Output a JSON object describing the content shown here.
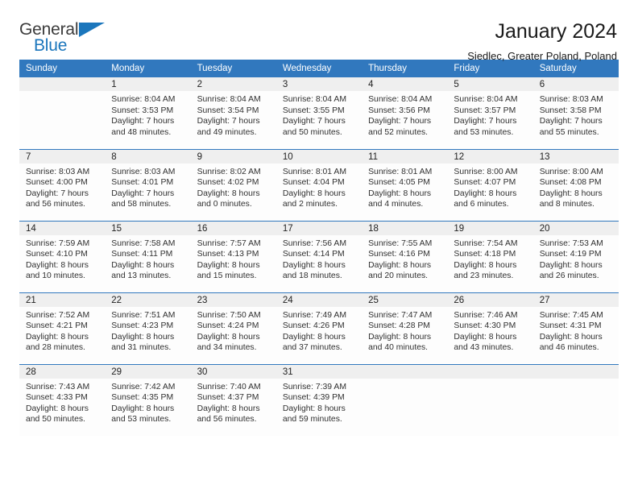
{
  "brand": {
    "word_one": "General",
    "word_two": "Blue",
    "accent_color": "#1b76bc",
    "triangle_icon": "triangle-icon"
  },
  "header": {
    "title": "January 2024",
    "subtitle": "Siedlec, Greater Poland, Poland"
  },
  "calendar": {
    "header_bg": "#3178be",
    "daynum_bg": "#efefef",
    "weekday_headers": [
      "Sunday",
      "Monday",
      "Tuesday",
      "Wednesday",
      "Thursday",
      "Friday",
      "Saturday"
    ],
    "weeks": [
      [
        {
          "day": "",
          "sunrise": "",
          "sunset": "",
          "daylight_line1": "",
          "daylight_line2": "",
          "empty": true
        },
        {
          "day": "1",
          "sunrise": "Sunrise: 8:04 AM",
          "sunset": "Sunset: 3:53 PM",
          "daylight_line1": "Daylight: 7 hours",
          "daylight_line2": "and 48 minutes."
        },
        {
          "day": "2",
          "sunrise": "Sunrise: 8:04 AM",
          "sunset": "Sunset: 3:54 PM",
          "daylight_line1": "Daylight: 7 hours",
          "daylight_line2": "and 49 minutes."
        },
        {
          "day": "3",
          "sunrise": "Sunrise: 8:04 AM",
          "sunset": "Sunset: 3:55 PM",
          "daylight_line1": "Daylight: 7 hours",
          "daylight_line2": "and 50 minutes."
        },
        {
          "day": "4",
          "sunrise": "Sunrise: 8:04 AM",
          "sunset": "Sunset: 3:56 PM",
          "daylight_line1": "Daylight: 7 hours",
          "daylight_line2": "and 52 minutes."
        },
        {
          "day": "5",
          "sunrise": "Sunrise: 8:04 AM",
          "sunset": "Sunset: 3:57 PM",
          "daylight_line1": "Daylight: 7 hours",
          "daylight_line2": "and 53 minutes."
        },
        {
          "day": "6",
          "sunrise": "Sunrise: 8:03 AM",
          "sunset": "Sunset: 3:58 PM",
          "daylight_line1": "Daylight: 7 hours",
          "daylight_line2": "and 55 minutes."
        }
      ],
      [
        {
          "day": "7",
          "sunrise": "Sunrise: 8:03 AM",
          "sunset": "Sunset: 4:00 PM",
          "daylight_line1": "Daylight: 7 hours",
          "daylight_line2": "and 56 minutes."
        },
        {
          "day": "8",
          "sunrise": "Sunrise: 8:03 AM",
          "sunset": "Sunset: 4:01 PM",
          "daylight_line1": "Daylight: 7 hours",
          "daylight_line2": "and 58 minutes."
        },
        {
          "day": "9",
          "sunrise": "Sunrise: 8:02 AM",
          "sunset": "Sunset: 4:02 PM",
          "daylight_line1": "Daylight: 8 hours",
          "daylight_line2": "and 0 minutes."
        },
        {
          "day": "10",
          "sunrise": "Sunrise: 8:01 AM",
          "sunset": "Sunset: 4:04 PM",
          "daylight_line1": "Daylight: 8 hours",
          "daylight_line2": "and 2 minutes."
        },
        {
          "day": "11",
          "sunrise": "Sunrise: 8:01 AM",
          "sunset": "Sunset: 4:05 PM",
          "daylight_line1": "Daylight: 8 hours",
          "daylight_line2": "and 4 minutes."
        },
        {
          "day": "12",
          "sunrise": "Sunrise: 8:00 AM",
          "sunset": "Sunset: 4:07 PM",
          "daylight_line1": "Daylight: 8 hours",
          "daylight_line2": "and 6 minutes."
        },
        {
          "day": "13",
          "sunrise": "Sunrise: 8:00 AM",
          "sunset": "Sunset: 4:08 PM",
          "daylight_line1": "Daylight: 8 hours",
          "daylight_line2": "and 8 minutes."
        }
      ],
      [
        {
          "day": "14",
          "sunrise": "Sunrise: 7:59 AM",
          "sunset": "Sunset: 4:10 PM",
          "daylight_line1": "Daylight: 8 hours",
          "daylight_line2": "and 10 minutes."
        },
        {
          "day": "15",
          "sunrise": "Sunrise: 7:58 AM",
          "sunset": "Sunset: 4:11 PM",
          "daylight_line1": "Daylight: 8 hours",
          "daylight_line2": "and 13 minutes."
        },
        {
          "day": "16",
          "sunrise": "Sunrise: 7:57 AM",
          "sunset": "Sunset: 4:13 PM",
          "daylight_line1": "Daylight: 8 hours",
          "daylight_line2": "and 15 minutes."
        },
        {
          "day": "17",
          "sunrise": "Sunrise: 7:56 AM",
          "sunset": "Sunset: 4:14 PM",
          "daylight_line1": "Daylight: 8 hours",
          "daylight_line2": "and 18 minutes."
        },
        {
          "day": "18",
          "sunrise": "Sunrise: 7:55 AM",
          "sunset": "Sunset: 4:16 PM",
          "daylight_line1": "Daylight: 8 hours",
          "daylight_line2": "and 20 minutes."
        },
        {
          "day": "19",
          "sunrise": "Sunrise: 7:54 AM",
          "sunset": "Sunset: 4:18 PM",
          "daylight_line1": "Daylight: 8 hours",
          "daylight_line2": "and 23 minutes."
        },
        {
          "day": "20",
          "sunrise": "Sunrise: 7:53 AM",
          "sunset": "Sunset: 4:19 PM",
          "daylight_line1": "Daylight: 8 hours",
          "daylight_line2": "and 26 minutes."
        }
      ],
      [
        {
          "day": "21",
          "sunrise": "Sunrise: 7:52 AM",
          "sunset": "Sunset: 4:21 PM",
          "daylight_line1": "Daylight: 8 hours",
          "daylight_line2": "and 28 minutes."
        },
        {
          "day": "22",
          "sunrise": "Sunrise: 7:51 AM",
          "sunset": "Sunset: 4:23 PM",
          "daylight_line1": "Daylight: 8 hours",
          "daylight_line2": "and 31 minutes."
        },
        {
          "day": "23",
          "sunrise": "Sunrise: 7:50 AM",
          "sunset": "Sunset: 4:24 PM",
          "daylight_line1": "Daylight: 8 hours",
          "daylight_line2": "and 34 minutes."
        },
        {
          "day": "24",
          "sunrise": "Sunrise: 7:49 AM",
          "sunset": "Sunset: 4:26 PM",
          "daylight_line1": "Daylight: 8 hours",
          "daylight_line2": "and 37 minutes."
        },
        {
          "day": "25",
          "sunrise": "Sunrise: 7:47 AM",
          "sunset": "Sunset: 4:28 PM",
          "daylight_line1": "Daylight: 8 hours",
          "daylight_line2": "and 40 minutes."
        },
        {
          "day": "26",
          "sunrise": "Sunrise: 7:46 AM",
          "sunset": "Sunset: 4:30 PM",
          "daylight_line1": "Daylight: 8 hours",
          "daylight_line2": "and 43 minutes."
        },
        {
          "day": "27",
          "sunrise": "Sunrise: 7:45 AM",
          "sunset": "Sunset: 4:31 PM",
          "daylight_line1": "Daylight: 8 hours",
          "daylight_line2": "and 46 minutes."
        }
      ],
      [
        {
          "day": "28",
          "sunrise": "Sunrise: 7:43 AM",
          "sunset": "Sunset: 4:33 PM",
          "daylight_line1": "Daylight: 8 hours",
          "daylight_line2": "and 50 minutes."
        },
        {
          "day": "29",
          "sunrise": "Sunrise: 7:42 AM",
          "sunset": "Sunset: 4:35 PM",
          "daylight_line1": "Daylight: 8 hours",
          "daylight_line2": "and 53 minutes."
        },
        {
          "day": "30",
          "sunrise": "Sunrise: 7:40 AM",
          "sunset": "Sunset: 4:37 PM",
          "daylight_line1": "Daylight: 8 hours",
          "daylight_line2": "and 56 minutes."
        },
        {
          "day": "31",
          "sunrise": "Sunrise: 7:39 AM",
          "sunset": "Sunset: 4:39 PM",
          "daylight_line1": "Daylight: 8 hours",
          "daylight_line2": "and 59 minutes."
        },
        {
          "day": "",
          "sunrise": "",
          "sunset": "",
          "daylight_line1": "",
          "daylight_line2": "",
          "empty": true
        },
        {
          "day": "",
          "sunrise": "",
          "sunset": "",
          "daylight_line1": "",
          "daylight_line2": "",
          "empty": true
        },
        {
          "day": "",
          "sunrise": "",
          "sunset": "",
          "daylight_line1": "",
          "daylight_line2": "",
          "empty": true
        }
      ]
    ]
  }
}
